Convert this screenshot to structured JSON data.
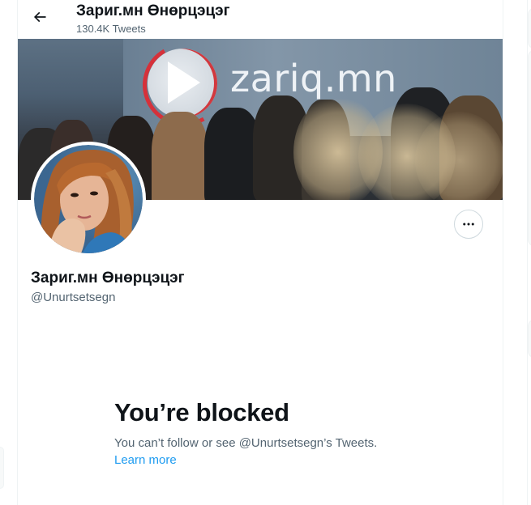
{
  "header": {
    "display_name": "Зариг.мн Өнөрцэцэг",
    "tweet_count": "130.4K Tweets",
    "back_icon": "arrow-left-icon"
  },
  "banner": {
    "brand_text": "zariq.mn",
    "description_icon": "play-logo-icon"
  },
  "profile": {
    "display_name": "Зариг.мн Өнөрцэцэг",
    "handle": "@Unurtsetsegn",
    "more_icon": "more-dots-icon"
  },
  "blocked": {
    "title": "You’re blocked",
    "description": "You can’t follow or see @Unurtsetsegn’s Tweets.",
    "learn_more": "Learn more"
  },
  "colors": {
    "text_primary": "#0f1419",
    "text_secondary": "#536471",
    "link": "#1d9bf0",
    "border": "#cfd9de"
  }
}
